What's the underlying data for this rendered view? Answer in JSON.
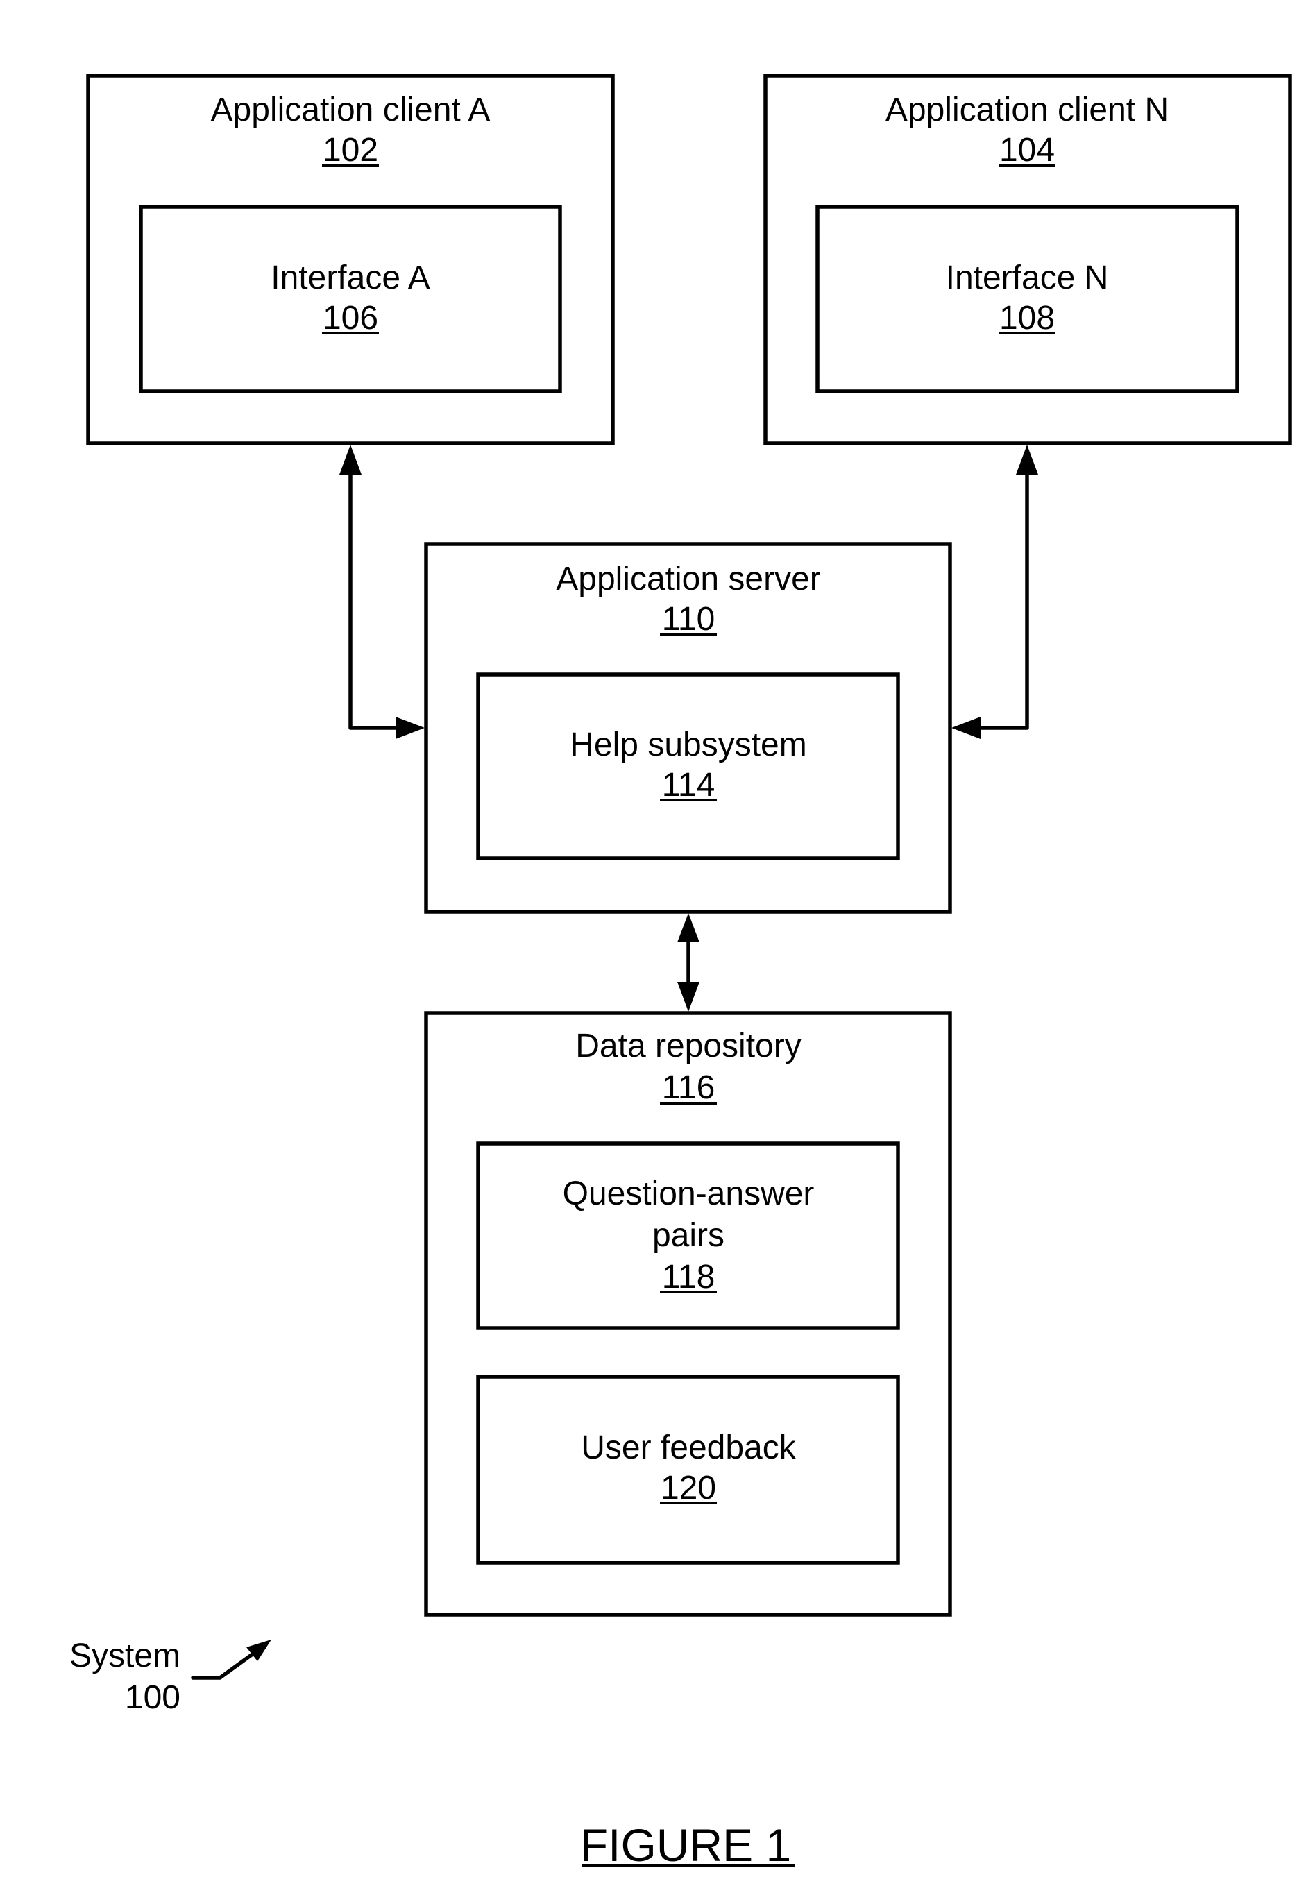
{
  "figure": {
    "title": "FIGURE 1",
    "system_label": "System",
    "system_ref": "100"
  },
  "components": {
    "client_a": {
      "label": "Application client A",
      "ref": "102"
    },
    "interface_a": {
      "label": "Interface A",
      "ref": "106"
    },
    "client_n": {
      "label": "Application client N",
      "ref": "104"
    },
    "interface_n": {
      "label": "Interface N",
      "ref": "108"
    },
    "app_server": {
      "label": "Application server",
      "ref": "110"
    },
    "help_subsystem": {
      "label": "Help subsystem",
      "ref": "114"
    },
    "data_repository": {
      "label": "Data repository",
      "ref": "116"
    },
    "qa_pairs": {
      "label_line1": "Question-answer",
      "label_line2": "pairs",
      "ref": "118"
    },
    "user_feedback": {
      "label": "User feedback",
      "ref": "120"
    }
  },
  "connections": [
    {
      "from": "client_a",
      "to": "app_server",
      "type": "bidirectional"
    },
    {
      "from": "client_n",
      "to": "app_server",
      "type": "bidirectional"
    },
    {
      "from": "app_server",
      "to": "data_repository",
      "type": "bidirectional"
    }
  ]
}
